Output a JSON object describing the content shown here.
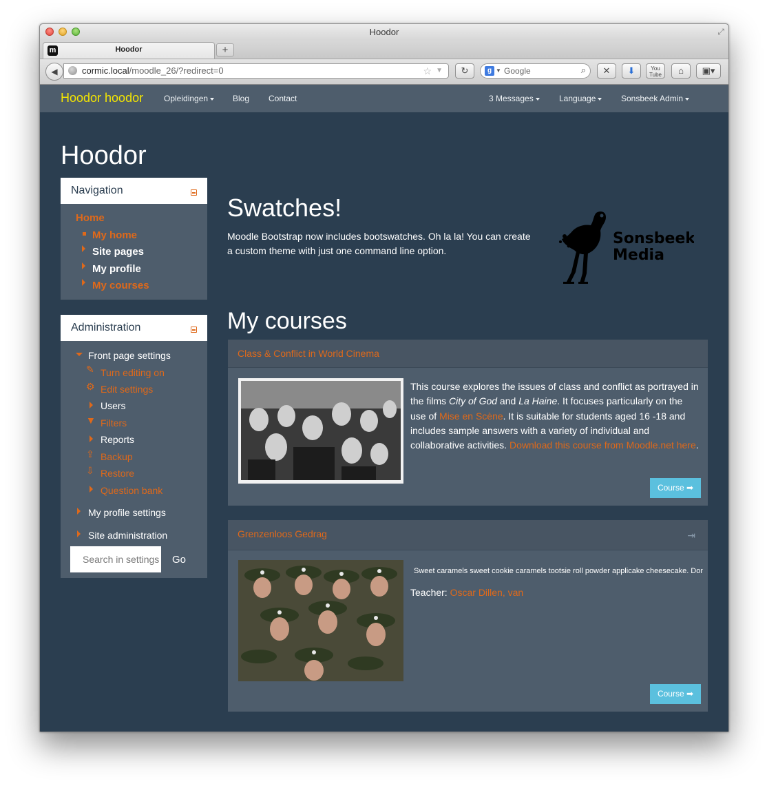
{
  "browser": {
    "window_title": "Hoodor",
    "tab_title": "Hoodor",
    "favicon": "m",
    "new_tab": "+",
    "url_host": "cormic.local",
    "url_path": "/moodle_26/?redirect=0",
    "search_placeholder": "Google",
    "search_engine_letter": "g"
  },
  "navbar": {
    "brand": "Hoodor hoodor",
    "links": [
      "Opleidingen",
      "Blog",
      "Contact"
    ],
    "right_links": [
      "3 Messages",
      "Language",
      "Sonsbeek Admin"
    ]
  },
  "page": {
    "title": "Hoodor"
  },
  "navigation": {
    "title": "Navigation",
    "home": "Home",
    "items": [
      "My home",
      "Site pages",
      "My profile",
      "My courses"
    ]
  },
  "administration": {
    "title": "Administration",
    "front_page_settings": "Front page settings",
    "items": [
      "Turn editing on",
      "Edit settings",
      "Users",
      "Filters",
      "Reports",
      "Backup",
      "Restore",
      "Question bank"
    ],
    "my_profile_settings": "My profile settings",
    "site_administration": "Site administration",
    "search_placeholder": "Search in settings",
    "go": "Go"
  },
  "hero": {
    "heading": "Swatches!",
    "text_line1": "Moodle Bootstrap now includes bootswatches. Oh la la! You can create",
    "text_line2": "a custom theme with just one command line option.",
    "logo_text1": "Sonsbeek",
    "logo_text2": "Media"
  },
  "my_courses": {
    "heading": "My courses",
    "courses": [
      {
        "title": "Class & Conflict in World Cinema",
        "p1": "This course explores the issues of class and conflict as portrayed in the films ",
        "film1": "City of God",
        "and": " and ",
        "film2": "La Haine",
        "p2": ". It focuses particularly on the use of ",
        "link1": "Mise en Scène",
        "p3": ".  It is suitable for students aged 16 -18 and includes sample answers with a variety of individual and collaborative activities. ",
        "link2": "Download this course from Moodle.net here",
        "p4": ".",
        "button": "Course"
      },
      {
        "title": "Grenzenloos Gedrag",
        "summary": "Sweet caramels sweet cookie caramels tootsie roll powder applicake cheesecake. Donut",
        "teacher_label": "Teacher: ",
        "teacher": "Oscar Dillen, van",
        "button": "Course"
      }
    ]
  },
  "colors": {
    "page_bg": "#2b3e50",
    "block_bg": "#4e5d6c",
    "accent": "#df691a",
    "brand": "#f5e600",
    "button": "#5bc0de"
  }
}
